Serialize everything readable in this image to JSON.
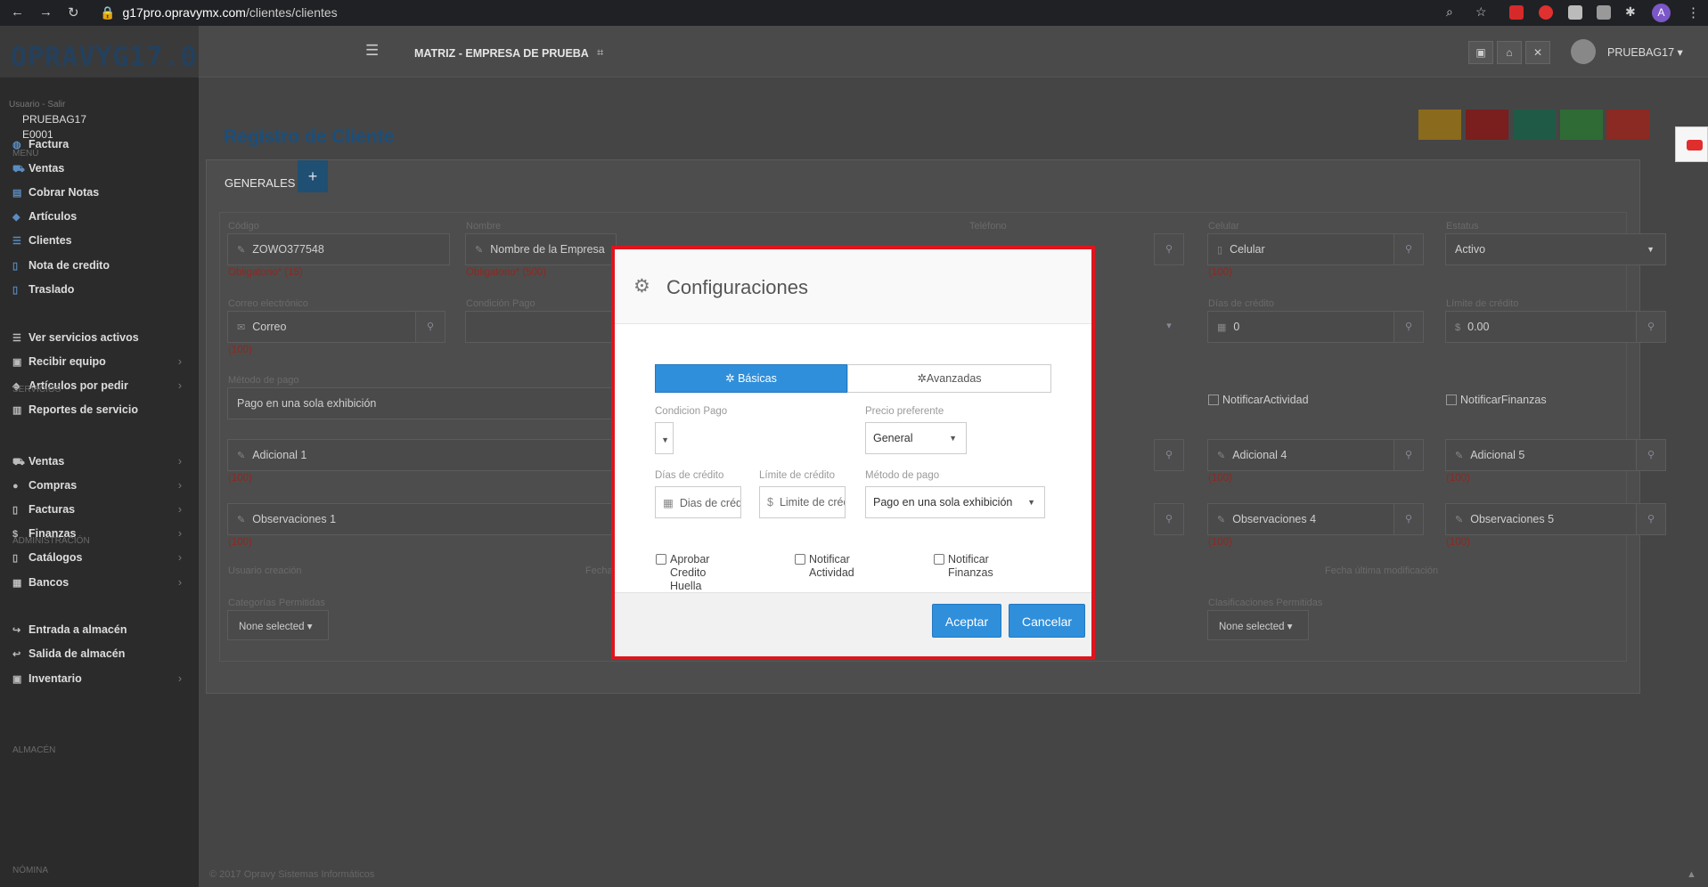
{
  "browser": {
    "url_host": "g17pro.opravymx.com",
    "url_path": "/clientes/clientes",
    "profile_initial": "A"
  },
  "sidebar": {
    "logo": "OPRAVYG17.0",
    "user_link": "Usuario - Salir",
    "user_name": "PRUEBAG17",
    "user_code": "E0001",
    "sections": {
      "menu": "MENÚ",
      "servicios": "SERVICIOS",
      "administracion": "ADMINISTRACIÓN",
      "almacen": "ALMACÉN",
      "nomina": "NÓMINA"
    },
    "items": [
      {
        "label": "Factura",
        "icon": "globe-icon"
      },
      {
        "label": "Ventas",
        "icon": "cart-icon"
      },
      {
        "label": "Cobrar Notas",
        "icon": "money-icon"
      },
      {
        "label": "Artículos",
        "icon": "tag-icon"
      },
      {
        "label": "Clientes",
        "icon": "list-icon"
      },
      {
        "label": "Nota de credito",
        "icon": "file-icon"
      },
      {
        "label": "Traslado",
        "icon": "file-icon"
      },
      {
        "label": "Ver servicios activos",
        "icon": "list-icon"
      },
      {
        "label": "Recibir equipo",
        "icon": "package-icon"
      },
      {
        "label": "Artículos por pedir",
        "icon": "tags-icon"
      },
      {
        "label": "Reportes de servicio",
        "icon": "chart-icon"
      },
      {
        "label": "Ventas",
        "icon": "cart-icon"
      },
      {
        "label": "Compras",
        "icon": "circle-icon"
      },
      {
        "label": "Facturas",
        "icon": "file-icon"
      },
      {
        "label": "Finanzas",
        "icon": "dollar-icon"
      },
      {
        "label": "Catálogos",
        "icon": "book-icon"
      },
      {
        "label": "Bancos",
        "icon": "bank-icon"
      },
      {
        "label": "Entrada a almacén",
        "icon": "sign-in-icon"
      },
      {
        "label": "Salida de almacén",
        "icon": "sign-out-icon"
      },
      {
        "label": "Inventario",
        "icon": "clipboard-icon"
      }
    ]
  },
  "topbar": {
    "company": "MATRIZ - EMPRESA DE PRUEBA",
    "user": "PRUEBAG17"
  },
  "page": {
    "title": "Registro de Cliente",
    "tab_generales": "GENERALES",
    "add_tab": "+",
    "footer": "© 2017 Opravy Sistemas Informáticos",
    "action_colors": [
      "#8a6a1c",
      "#7a1e1e",
      "#1f5a46",
      "#2e6b35",
      "#8a2a22"
    ]
  },
  "form": {
    "codigo_label": "Código",
    "codigo_value": "ZOWO377548",
    "codigo_error": "Obligatorio* (15)",
    "nombre_label": "Nombre",
    "nombre_placeholder": "Nombre de la Empresa",
    "nombre_error": "Obligatorio* (500)",
    "telefono_label": "Teléfono",
    "celular_label": "Celular",
    "celular_placeholder": "Celular",
    "celular_count": "(100)",
    "estatus_label": "Estatus",
    "estatus_value": "Activo",
    "correo_label": "Correo electrónico",
    "correo_placeholder": "Correo",
    "correo_count": "(100)",
    "condicion_label": "Condición Pago",
    "dias_label": "Días de crédito",
    "dias_value": "0",
    "limite_label": "Límite de crédito",
    "limite_value": "0.00",
    "metodo_label": "Método de pago",
    "metodo_value": "Pago en una sola exhibición",
    "notif_actividad": "NotificarActividad",
    "notif_finanzas": "NotificarFinanzas",
    "adicional1": "Adicional 1",
    "adicional4": "Adicional 4",
    "adicional5": "Adicional 5",
    "observaciones1": "Observaciones 1",
    "observaciones4": "Observaciones 4",
    "observaciones5": "Observaciones 5",
    "count100": "(100)",
    "usuario_creacion": "Usuario creación",
    "fecha_creacion": "Fecha",
    "fecha_mod": "Fecha última modificación",
    "categorias_label": "Categorías Permitidas",
    "clasificaciones_label": "Clasificaciones Permitidas",
    "none_selected": "None selected"
  },
  "modal": {
    "title": "Configuraciones",
    "tab_basicas": "Básicas",
    "tab_avanzadas": "Avanzadas",
    "condicion_label": "Condicion Pago",
    "precio_label": "Precio preferente",
    "precio_value": "General",
    "dias_label": "Días de crédito",
    "dias_placeholder": "Dias de crédito",
    "limite_label": "Límite de crédito",
    "limite_placeholder": "Limite de crédito",
    "metodo_label": "Método de pago",
    "metodo_value": "Pago en una sola exhibición",
    "chk_aprobar": "Aprobar Credito Huella",
    "chk_actividad": "Notificar Actividad",
    "chk_finanzas": "Notificar Finanzas",
    "btn_aceptar": "Aceptar",
    "btn_cancelar": "Cancelar",
    "accent": "#2f8fdb",
    "highlight": "#e0141c"
  }
}
